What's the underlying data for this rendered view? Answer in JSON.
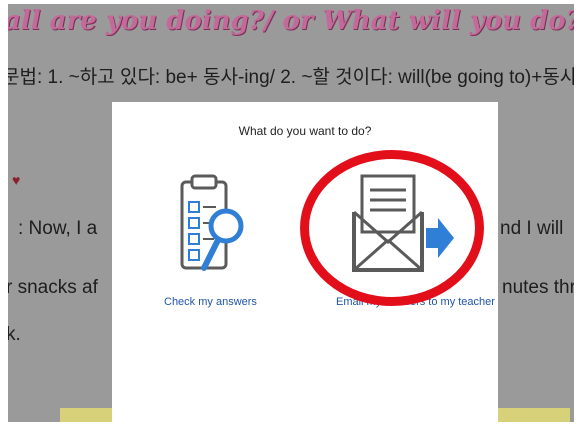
{
  "background": {
    "title": "all are you doing?/ or What will you do?",
    "grammar_line": "문법: 1. ~하고 있다: be+ 동사-ing/ 2. ~할 것이다: will(be going to)+동사",
    "line_now": ": Now, I a",
    "line_now_right": "nd I will",
    "line_snacks": "r snacks af",
    "line_snacks_right": "nutes thre",
    "line_k": "k."
  },
  "dialog": {
    "title": "What do you want to do?",
    "options": [
      {
        "label": "Check my answers",
        "icon": "clipboard-magnifier-icon"
      },
      {
        "label": "Email my answers to my teacher",
        "icon": "envelope-arrow-icon"
      }
    ]
  },
  "colors": {
    "overlay": "#9a9a9a",
    "link": "#1f55a8",
    "highlight_circle": "#e20f1a",
    "icon_blue": "#2f7fd6",
    "icon_gray": "#5a5a5a"
  }
}
